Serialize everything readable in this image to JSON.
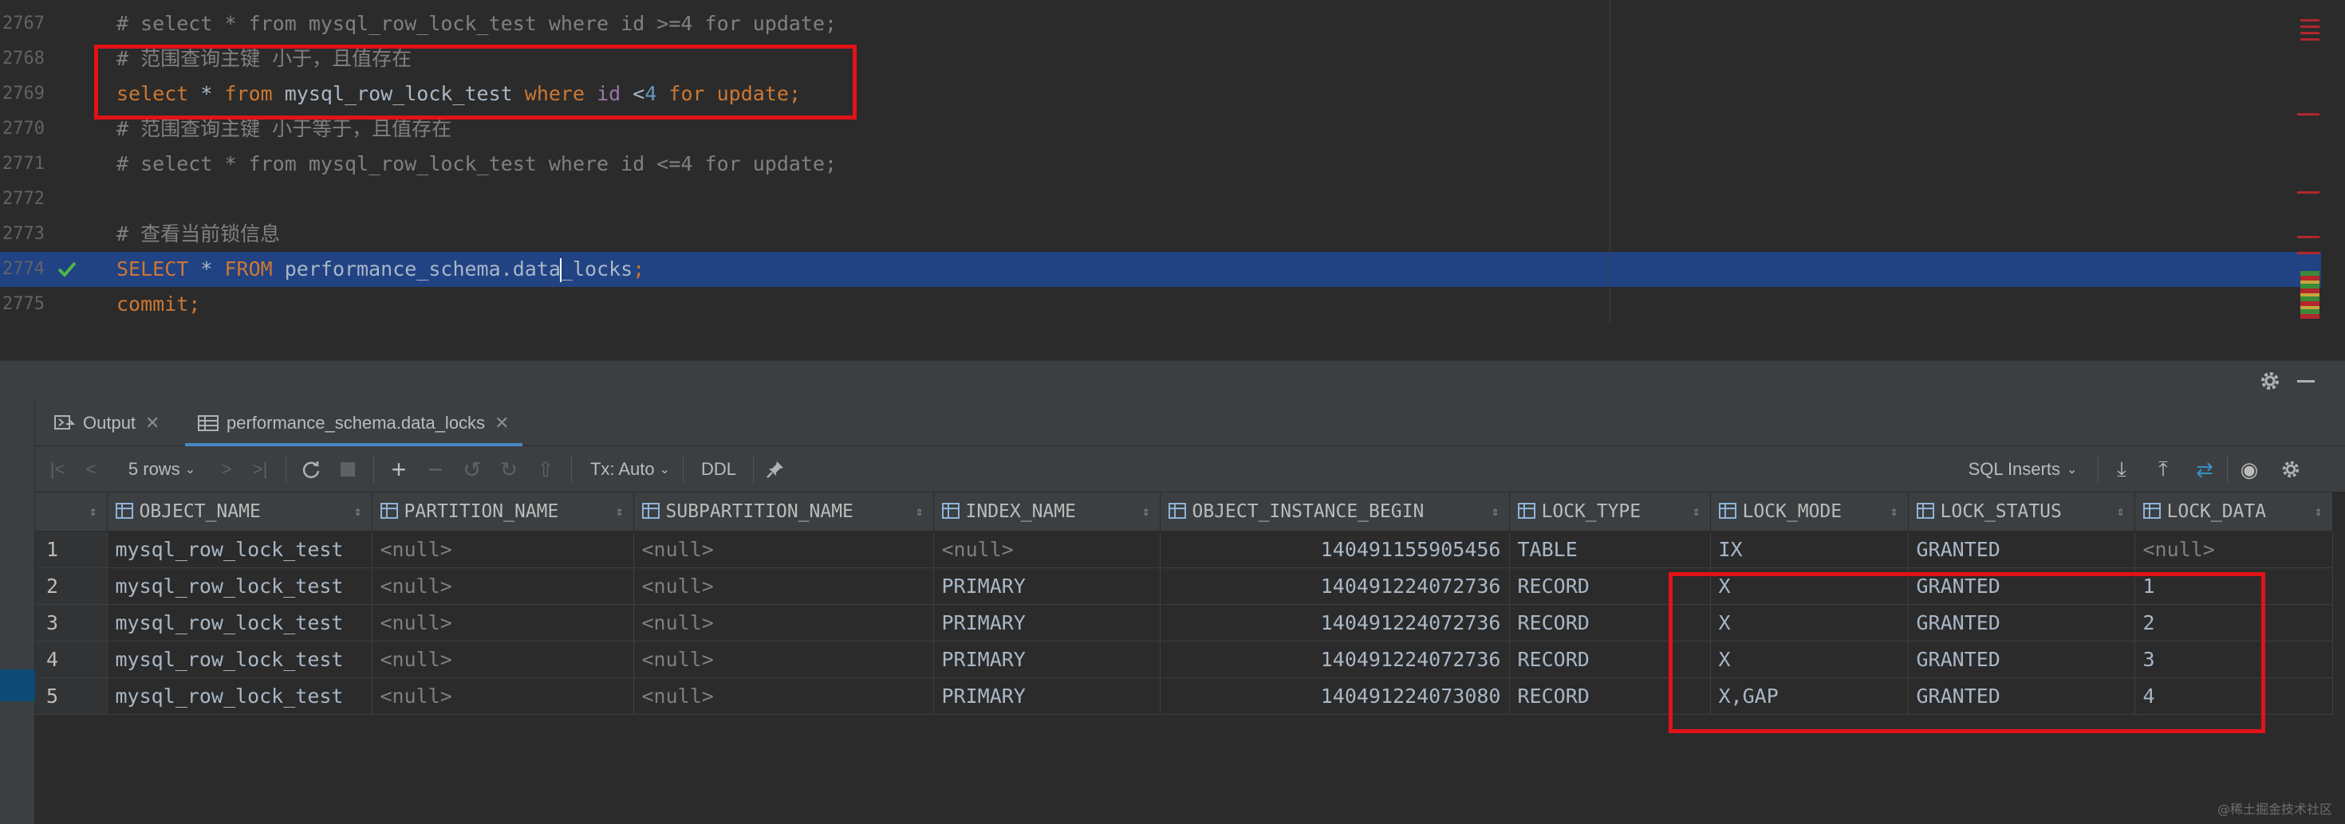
{
  "editor": {
    "lines": [
      {
        "num": "2767",
        "tokens": [
          {
            "t": "# select * from mysql_row_lock_test where id >=4 for update;",
            "c": "c"
          }
        ]
      },
      {
        "num": "2768",
        "tokens": [
          {
            "t": "# 范围查询主键 小于，且值存在",
            "c": "c"
          }
        ]
      },
      {
        "num": "2769",
        "tokens": [
          {
            "t": "select",
            "c": "k"
          },
          {
            "t": " * ",
            "c": "p"
          },
          {
            "t": "from",
            "c": "k"
          },
          {
            "t": " mysql_row_lock_test ",
            "c": "p"
          },
          {
            "t": "where",
            "c": "k"
          },
          {
            "t": " id ",
            "c": "v"
          },
          {
            "t": "<",
            "c": "p"
          },
          {
            "t": "4",
            "c": "n"
          },
          {
            "t": " for update;",
            "c": "k"
          }
        ]
      },
      {
        "num": "2770",
        "tokens": [
          {
            "t": "# 范围查询主键 小于等于，且值存在",
            "c": "c"
          }
        ]
      },
      {
        "num": "2771",
        "tokens": [
          {
            "t": "# select * from mysql_row_lock_test where id <=4 for update;",
            "c": "c"
          }
        ]
      },
      {
        "num": "2772",
        "tokens": []
      },
      {
        "num": "2773",
        "tokens": [
          {
            "t": "# 查看当前锁信息",
            "c": "c"
          }
        ]
      },
      {
        "num": "2774",
        "tokens": [
          {
            "t": "SELECT",
            "c": "k"
          },
          {
            "t": " * ",
            "c": "p"
          },
          {
            "t": "FROM",
            "c": "k"
          },
          {
            "t": " performance_schema.data",
            "c": "p"
          },
          {
            "t": "",
            "c": "caret"
          },
          {
            "t": "_locks",
            "c": "p"
          },
          {
            "t": ";",
            "c": "k"
          }
        ],
        "selected": true,
        "check": true
      },
      {
        "num": "2775",
        "tokens": [
          {
            "t": "commit;",
            "c": "k"
          }
        ]
      }
    ]
  },
  "tabs": [
    {
      "label": "Output",
      "icon": "output-icon"
    },
    {
      "label": "performance_schema.data_locks",
      "icon": "table-icon",
      "active": true
    }
  ],
  "toolbar": {
    "rows_label": "5 rows",
    "tx_label": "Tx: Auto",
    "ddl_label": "DDL",
    "export_label": "SQL Inserts"
  },
  "grid": {
    "columns": [
      "OBJECT_NAME",
      "PARTITION_NAME",
      "SUBPARTITION_NAME",
      "INDEX_NAME",
      "OBJECT_INSTANCE_BEGIN",
      "LOCK_TYPE",
      "LOCK_MODE",
      "LOCK_STATUS",
      "LOCK_DATA"
    ],
    "rows": [
      [
        "1",
        "mysql_row_lock_test",
        "<null>",
        "<null>",
        "<null>",
        "140491155905456",
        "TABLE",
        "IX",
        "GRANTED",
        "<null>"
      ],
      [
        "2",
        "mysql_row_lock_test",
        "<null>",
        "<null>",
        "PRIMARY",
        "140491224072736",
        "RECORD",
        "X",
        "GRANTED",
        "1"
      ],
      [
        "3",
        "mysql_row_lock_test",
        "<null>",
        "<null>",
        "PRIMARY",
        "140491224072736",
        "RECORD",
        "X",
        "GRANTED",
        "2"
      ],
      [
        "4",
        "mysql_row_lock_test",
        "<null>",
        "<null>",
        "PRIMARY",
        "140491224072736",
        "RECORD",
        "X",
        "GRANTED",
        "3"
      ],
      [
        "5",
        "mysql_row_lock_test",
        "<null>",
        "<null>",
        "PRIMARY",
        "140491224073080",
        "RECORD",
        "X,GAP",
        "GRANTED",
        "4"
      ]
    ]
  },
  "watermark": "@稀土掘金技术社区",
  "colors": {
    "highlight_box": "#e21318",
    "selection": "#214283",
    "keyword": "#cc7832"
  }
}
